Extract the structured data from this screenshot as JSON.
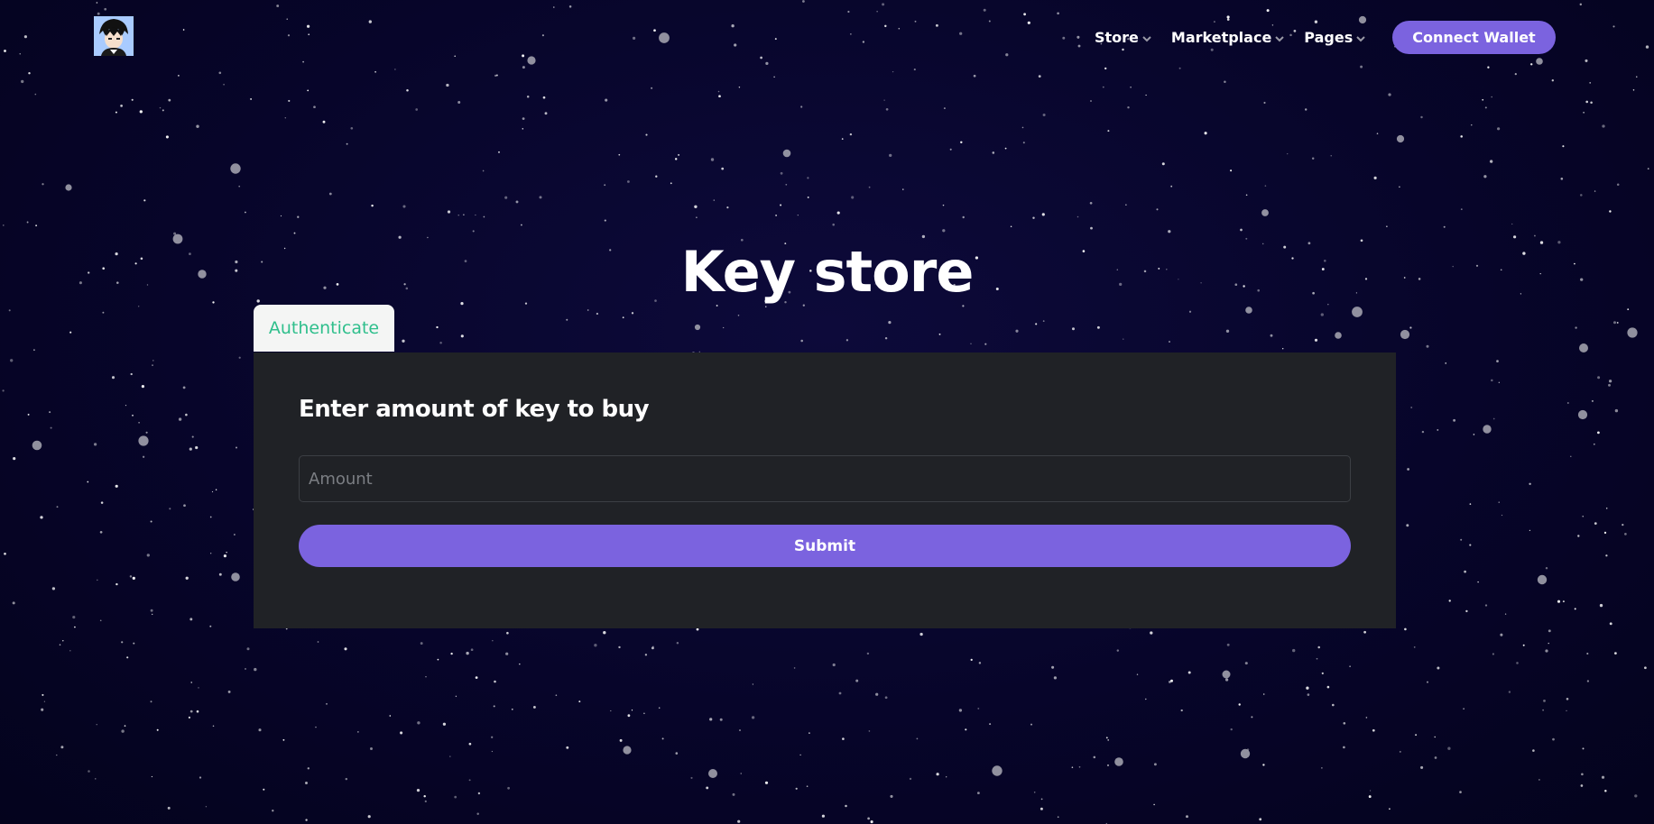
{
  "header": {
    "logo_name": "avatar-logo",
    "nav": [
      {
        "label": "Store"
      },
      {
        "label": "Marketplace"
      },
      {
        "label": "Pages"
      }
    ],
    "connect_wallet_label": "Connect Wallet"
  },
  "main": {
    "title": "Key store",
    "tabs": [
      {
        "label": "Authenticate"
      }
    ],
    "form": {
      "heading": "Enter amount of key to buy",
      "amount_placeholder": "Amount",
      "amount_value": "",
      "submit_label": "Submit"
    }
  },
  "colors": {
    "background": "#07052a",
    "accent": "#7b63df",
    "card": "#202226",
    "tab_text": "#2fbf8c"
  },
  "icons": {
    "nav_chevron": "chevron-down-icon"
  }
}
